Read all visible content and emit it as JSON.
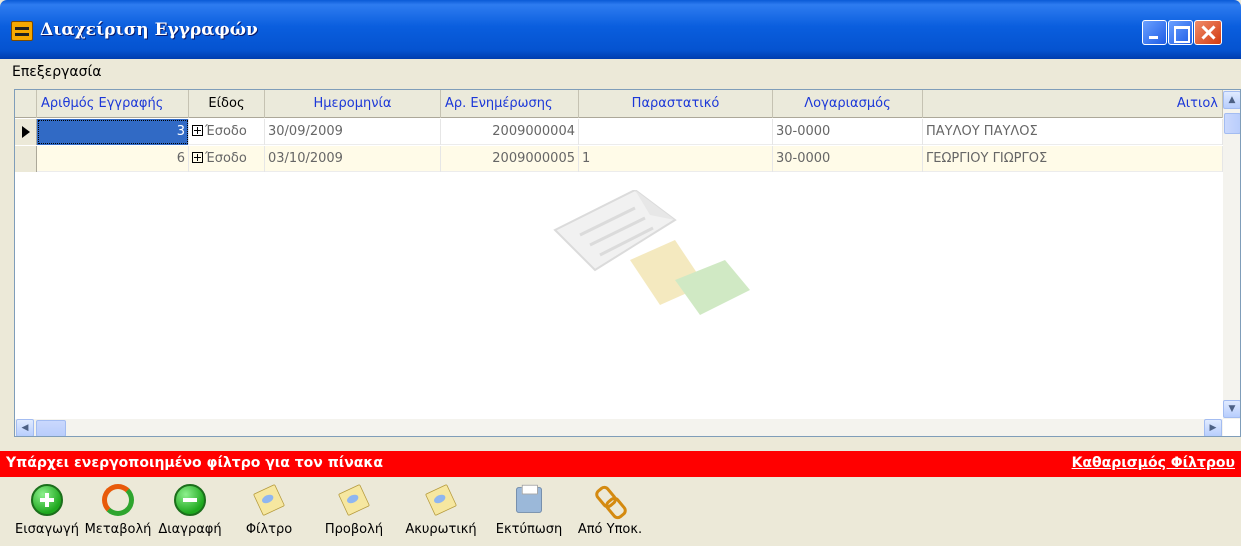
{
  "window": {
    "title": "Διαχείριση Εγγραφών"
  },
  "menu": {
    "items": [
      "Επεξεργασία"
    ]
  },
  "grid": {
    "columns": [
      "Αριθμός Εγγραφής",
      "Είδος",
      "Ημερομηνία",
      "Αρ. Ενημέρωσης",
      "Παραστατικό",
      "Λογαριασμός",
      "Αιτιολ"
    ],
    "rows": [
      {
        "record": "3",
        "type": "Έσοδο",
        "date": "30/09/2009",
        "update_no": "2009000004",
        "document": "",
        "account": "30-0000",
        "description": "ΠΑΥΛΟΥ ΠΑΥΛΟΣ"
      },
      {
        "record": "6",
        "type": "Έσοδο",
        "date": "03/10/2009",
        "update_no": "2009000005",
        "document": "1",
        "account": "30-0000",
        "description": "ΓΕΩΡΓΙΟΥ ΓΙΩΡΓΟΣ"
      }
    ]
  },
  "filter": {
    "message": "Υπάρχει ενεργοποιημένο φίλτρο για τον πίνακα",
    "clear_label": "Καθαρισμός Φίλτρου"
  },
  "toolbar": {
    "insert": "Εισαγωγή",
    "modify": "Μεταβολή",
    "delete": "Διαγραφή",
    "filter": "Φίλτρο",
    "view": "Προβολή",
    "reversal": "Ακυρωτική",
    "print": "Εκτύπωση",
    "from_branch": "Από Υποκ."
  },
  "colors": {
    "filter_bar": "#ff0000",
    "header_text": "#1c38d8",
    "titlebar": "#0a5ede"
  }
}
